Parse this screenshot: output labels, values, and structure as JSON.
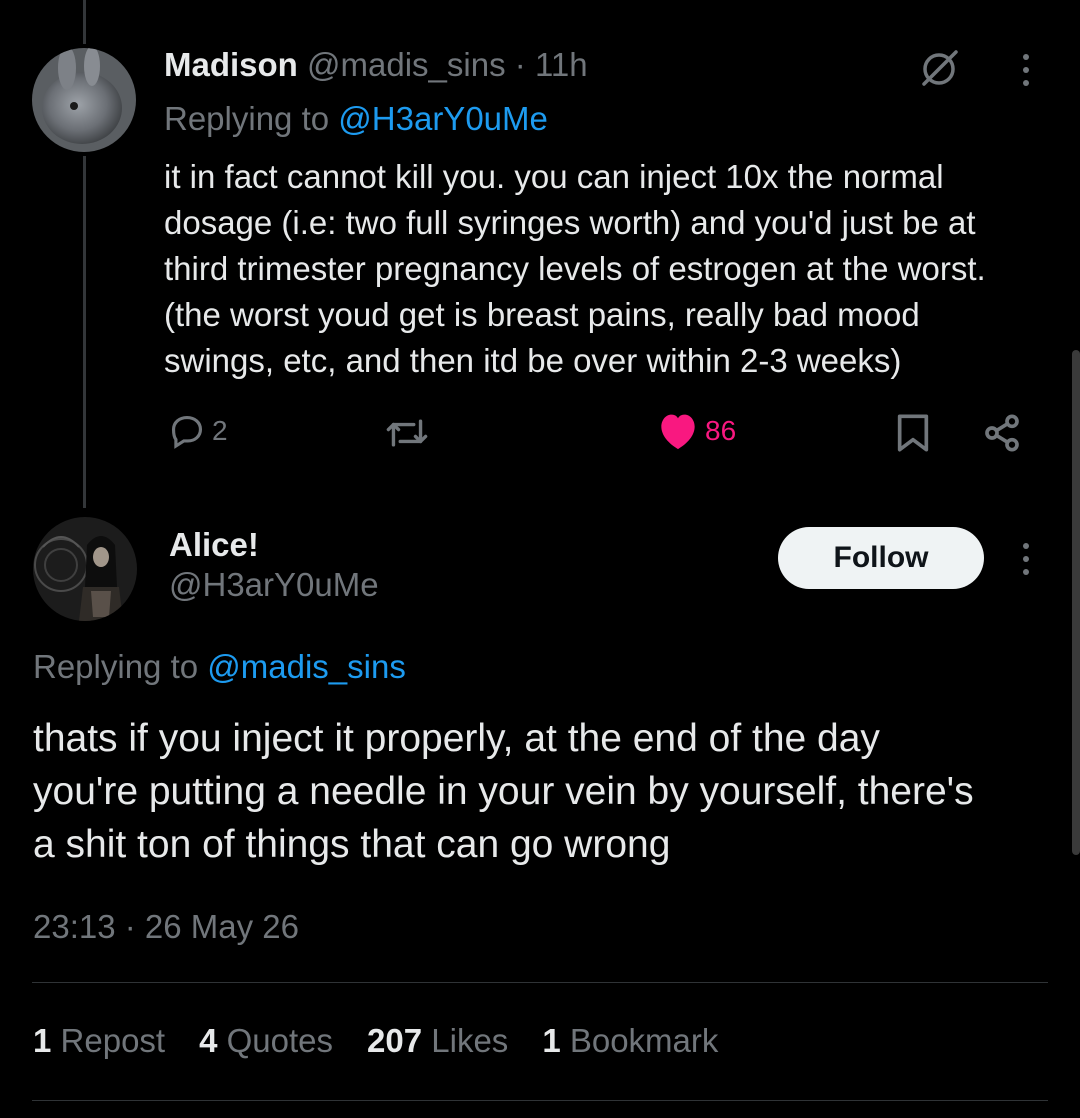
{
  "tweet1": {
    "display_name": "Madison",
    "handle": "@madis_sins",
    "separator": "·",
    "time": "11h",
    "replying_prefix": "Replying to",
    "replying_handle": "@H3arY0uMe",
    "text": "it in fact cannot kill you. you can inject 10x the normal\ndosage (i.e: two full syringes worth) and you'd just be at\nthird trimester pregnancy levels of estrogen at the worst.\n(the worst youd get is breast pains, really bad mood\nswings, etc, and then itd be over within 2-3 weeks)",
    "reply_count": "2",
    "like_count": "86",
    "icons": [
      "grok-icon",
      "more-icon",
      "reply-icon",
      "repost-icon",
      "like-icon",
      "bookmark-icon",
      "share-icon"
    ]
  },
  "tweet2": {
    "display_name": "Alice!",
    "handle": "@H3arY0uMe",
    "follow_label": "Follow",
    "replying_prefix": "Replying to",
    "replying_handle": "@madis_sins",
    "text": "thats if you inject it properly, at the end of the day\nyou're putting a needle in your vein by yourself, there's\na shit ton of things that can go wrong",
    "timestamp": "23:13 · 26 May 26",
    "stats": [
      {
        "count": "1",
        "label": "Repost"
      },
      {
        "count": "4",
        "label": "Quotes"
      },
      {
        "count": "207",
        "label": "Likes"
      },
      {
        "count": "1",
        "label": "Bookmark"
      }
    ]
  },
  "colors": {
    "background": "#000000",
    "link": "#1d9bf0",
    "like": "#f91880",
    "muted": "#71767b"
  }
}
